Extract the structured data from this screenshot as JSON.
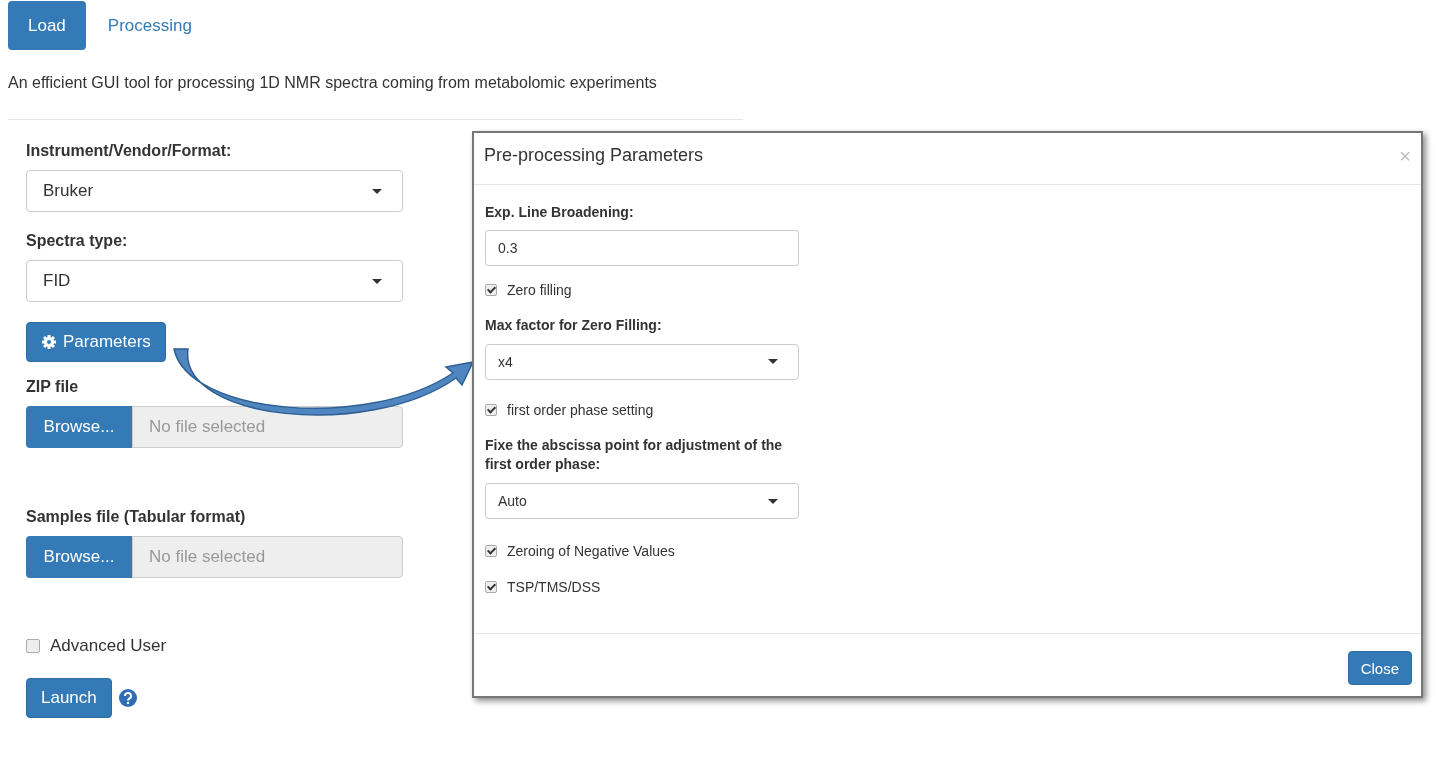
{
  "tabs": [
    {
      "label": "Load",
      "selected": true
    },
    {
      "label": "Processing",
      "selected": false
    }
  ],
  "description": "An efficient GUI tool for processing 1D NMR spectra coming from metabolomic experiments",
  "form": [
    {
      "kind": "select",
      "label": "Instrument/Vendor/Format:",
      "value": "Bruker"
    },
    {
      "kind": "select",
      "label": "Spectra type:",
      "value": "FID"
    },
    {
      "kind": "button",
      "label": "Parameters"
    },
    {
      "kind": "file",
      "label": "ZIP file",
      "button": "Browse...",
      "placeholder": "No file selected"
    },
    {
      "kind": "file",
      "label": "Samples file (Tabular format)",
      "button": "Browse...",
      "placeholder": "No file selected"
    },
    {
      "kind": "checkbox",
      "label": "Advanced User",
      "checked": false
    },
    {
      "kind": "launch",
      "label": "Launch"
    }
  ],
  "modal": {
    "title": "Pre-processing Parameters",
    "close_symbol": "×",
    "fields": [
      {
        "kind": "input",
        "label": "Exp. Line Broadening:",
        "value": "0.3"
      },
      {
        "kind": "checkbox",
        "label": "Zero filling",
        "checked": true
      },
      {
        "kind": "select",
        "label": "Max factor for Zero Filling:",
        "value": "x4"
      },
      {
        "kind": "checkbox",
        "label": "first order phase setting",
        "checked": true
      },
      {
        "kind": "select",
        "label": "Fixe the abscissa point for adjustment of the first order phase:",
        "value": "Auto"
      },
      {
        "kind": "checkbox",
        "label": "Zeroing of Negative Values",
        "checked": true
      },
      {
        "kind": "checkbox",
        "label": "TSP/TMS/DSS",
        "checked": true
      }
    ],
    "button": "Close"
  }
}
